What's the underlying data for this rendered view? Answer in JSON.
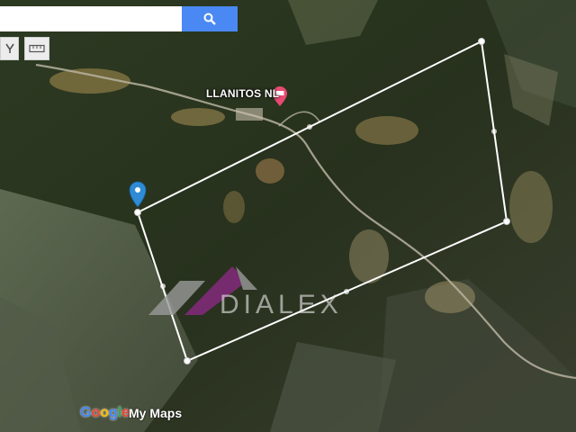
{
  "search": {
    "placeholder": "",
    "value": ""
  },
  "place_label": "LLANITOS NL",
  "watermark": {
    "text": "DIALEX"
  },
  "attribution": {
    "google": [
      "G",
      "o",
      "o",
      "g",
      "l",
      "e"
    ],
    "product": "My Maps"
  },
  "colors": {
    "search_button": "#4a89f3",
    "polygon_stroke": "#ffffff",
    "marker_pin": "#2e8bd4",
    "hotel_pin": "#e84a72",
    "watermark_purple": "#8a2a82",
    "watermark_grey": "#9a9a9a"
  },
  "icons": {
    "search": "search-icon",
    "tool1": "selection-tool-icon",
    "tool2": "ruler-icon"
  }
}
